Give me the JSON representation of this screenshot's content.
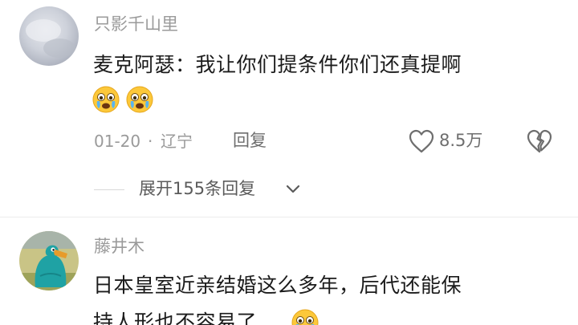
{
  "comments": [
    {
      "username": "只影千山里",
      "text": "麦克阿瑟：我让你们提条件你们还真提啊",
      "emojis": [
        "crying-face-icon",
        "crying-face-icon"
      ],
      "date": "01-20",
      "separator": "·",
      "location": "辽宁",
      "reply_label": "回复",
      "like_count": "8.5万",
      "expand_label": "展开155条回复"
    },
    {
      "username": "藤井木",
      "text_line1": "日本皇室近亲结婚这么多年，后代还能保",
      "text_line2": "持人形也不容易了",
      "emojis": [
        "crying-face-icon"
      ]
    }
  ],
  "colors": {
    "username": "#9a9a9a",
    "text": "#1b1b1b",
    "meta": "#9a9a9a",
    "accent_gray": "#6e6e6e"
  }
}
